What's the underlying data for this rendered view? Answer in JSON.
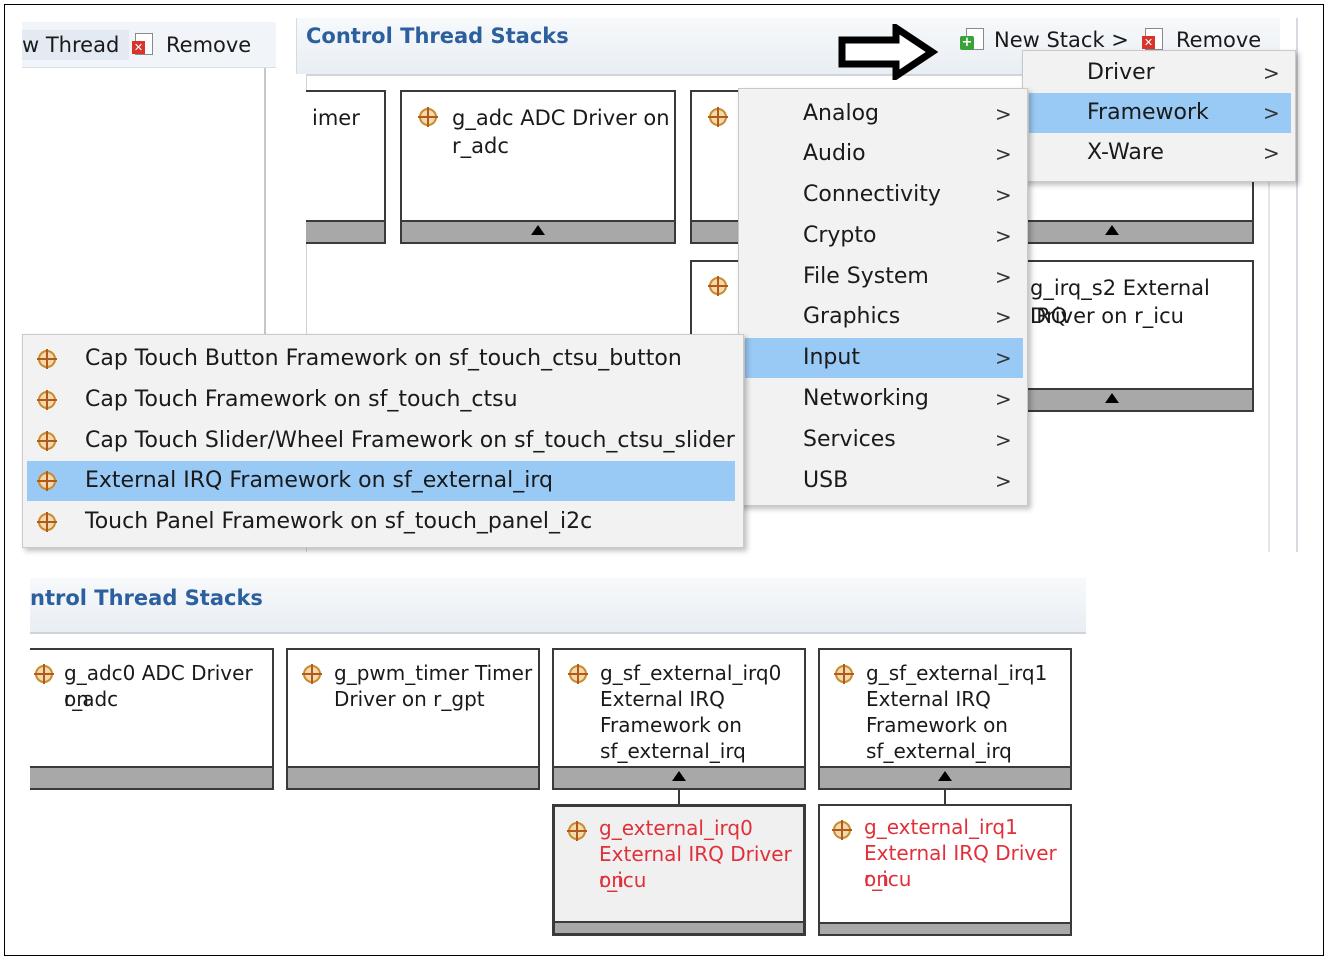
{
  "toolbar": {
    "new_thread_label": "w Thread",
    "remove_label": "Remove"
  },
  "top_panel": {
    "title": "Control Thread Stacks",
    "new_stack_label": "New Stack >",
    "remove_label": "Remove"
  },
  "top_boxes": {
    "timer_partial": "imer",
    "adc_line1": "g_adc ADC Driver on",
    "adc_line2": "r_adc",
    "irq_s2_line1": "g_irq_s2 External IRQ",
    "irq_s2_line2": "Driver on r_icu"
  },
  "new_stack_menu": {
    "items": [
      {
        "label": "Driver"
      },
      {
        "label": "Framework"
      },
      {
        "label": "X-Ware"
      }
    ],
    "selected": "Framework"
  },
  "framework_menu": {
    "items": [
      {
        "label": "Analog"
      },
      {
        "label": "Audio"
      },
      {
        "label": "Connectivity"
      },
      {
        "label": "Crypto"
      },
      {
        "label": "File System"
      },
      {
        "label": "Graphics"
      },
      {
        "label": "Input"
      },
      {
        "label": "Networking"
      },
      {
        "label": "Services"
      },
      {
        "label": "USB"
      }
    ],
    "selected": "Input"
  },
  "input_menu": {
    "items": [
      {
        "label": "Cap Touch Button Framework on sf_touch_ctsu_button"
      },
      {
        "label": "Cap Touch Framework on sf_touch_ctsu"
      },
      {
        "label": "Cap Touch Slider/Wheel Framework on sf_touch_ctsu_slider"
      },
      {
        "label": "External IRQ Framework on sf_external_irq"
      },
      {
        "label": "Touch Panel Framework on sf_touch_panel_i2c"
      }
    ],
    "selected": "External IRQ Framework on sf_external_irq"
  },
  "bottom_panel": {
    "title": "ntrol Thread Stacks",
    "boxes": [
      {
        "lines": [
          "g_adc0 ADC Driver on",
          "r_adc"
        ]
      },
      {
        "lines": [
          "g_pwm_timer Timer",
          "Driver on r_gpt"
        ]
      },
      {
        "lines": [
          "g_sf_external_irq0",
          "External IRQ",
          "Framework on",
          "sf_external_irq"
        ]
      },
      {
        "lines": [
          "g_sf_external_irq1",
          "External IRQ",
          "Framework on",
          "sf_external_irq"
        ]
      }
    ],
    "child_boxes": [
      {
        "lines": [
          "g_external_irq0",
          "External IRQ Driver on",
          "r_icu"
        ]
      },
      {
        "lines": [
          "g_external_irq1",
          "External IRQ Driver on",
          "r_icu"
        ]
      }
    ]
  },
  "colors": {
    "title_blue": "#2c5f9e",
    "highlight": "#99c9f5",
    "error_red": "#e0303a"
  }
}
